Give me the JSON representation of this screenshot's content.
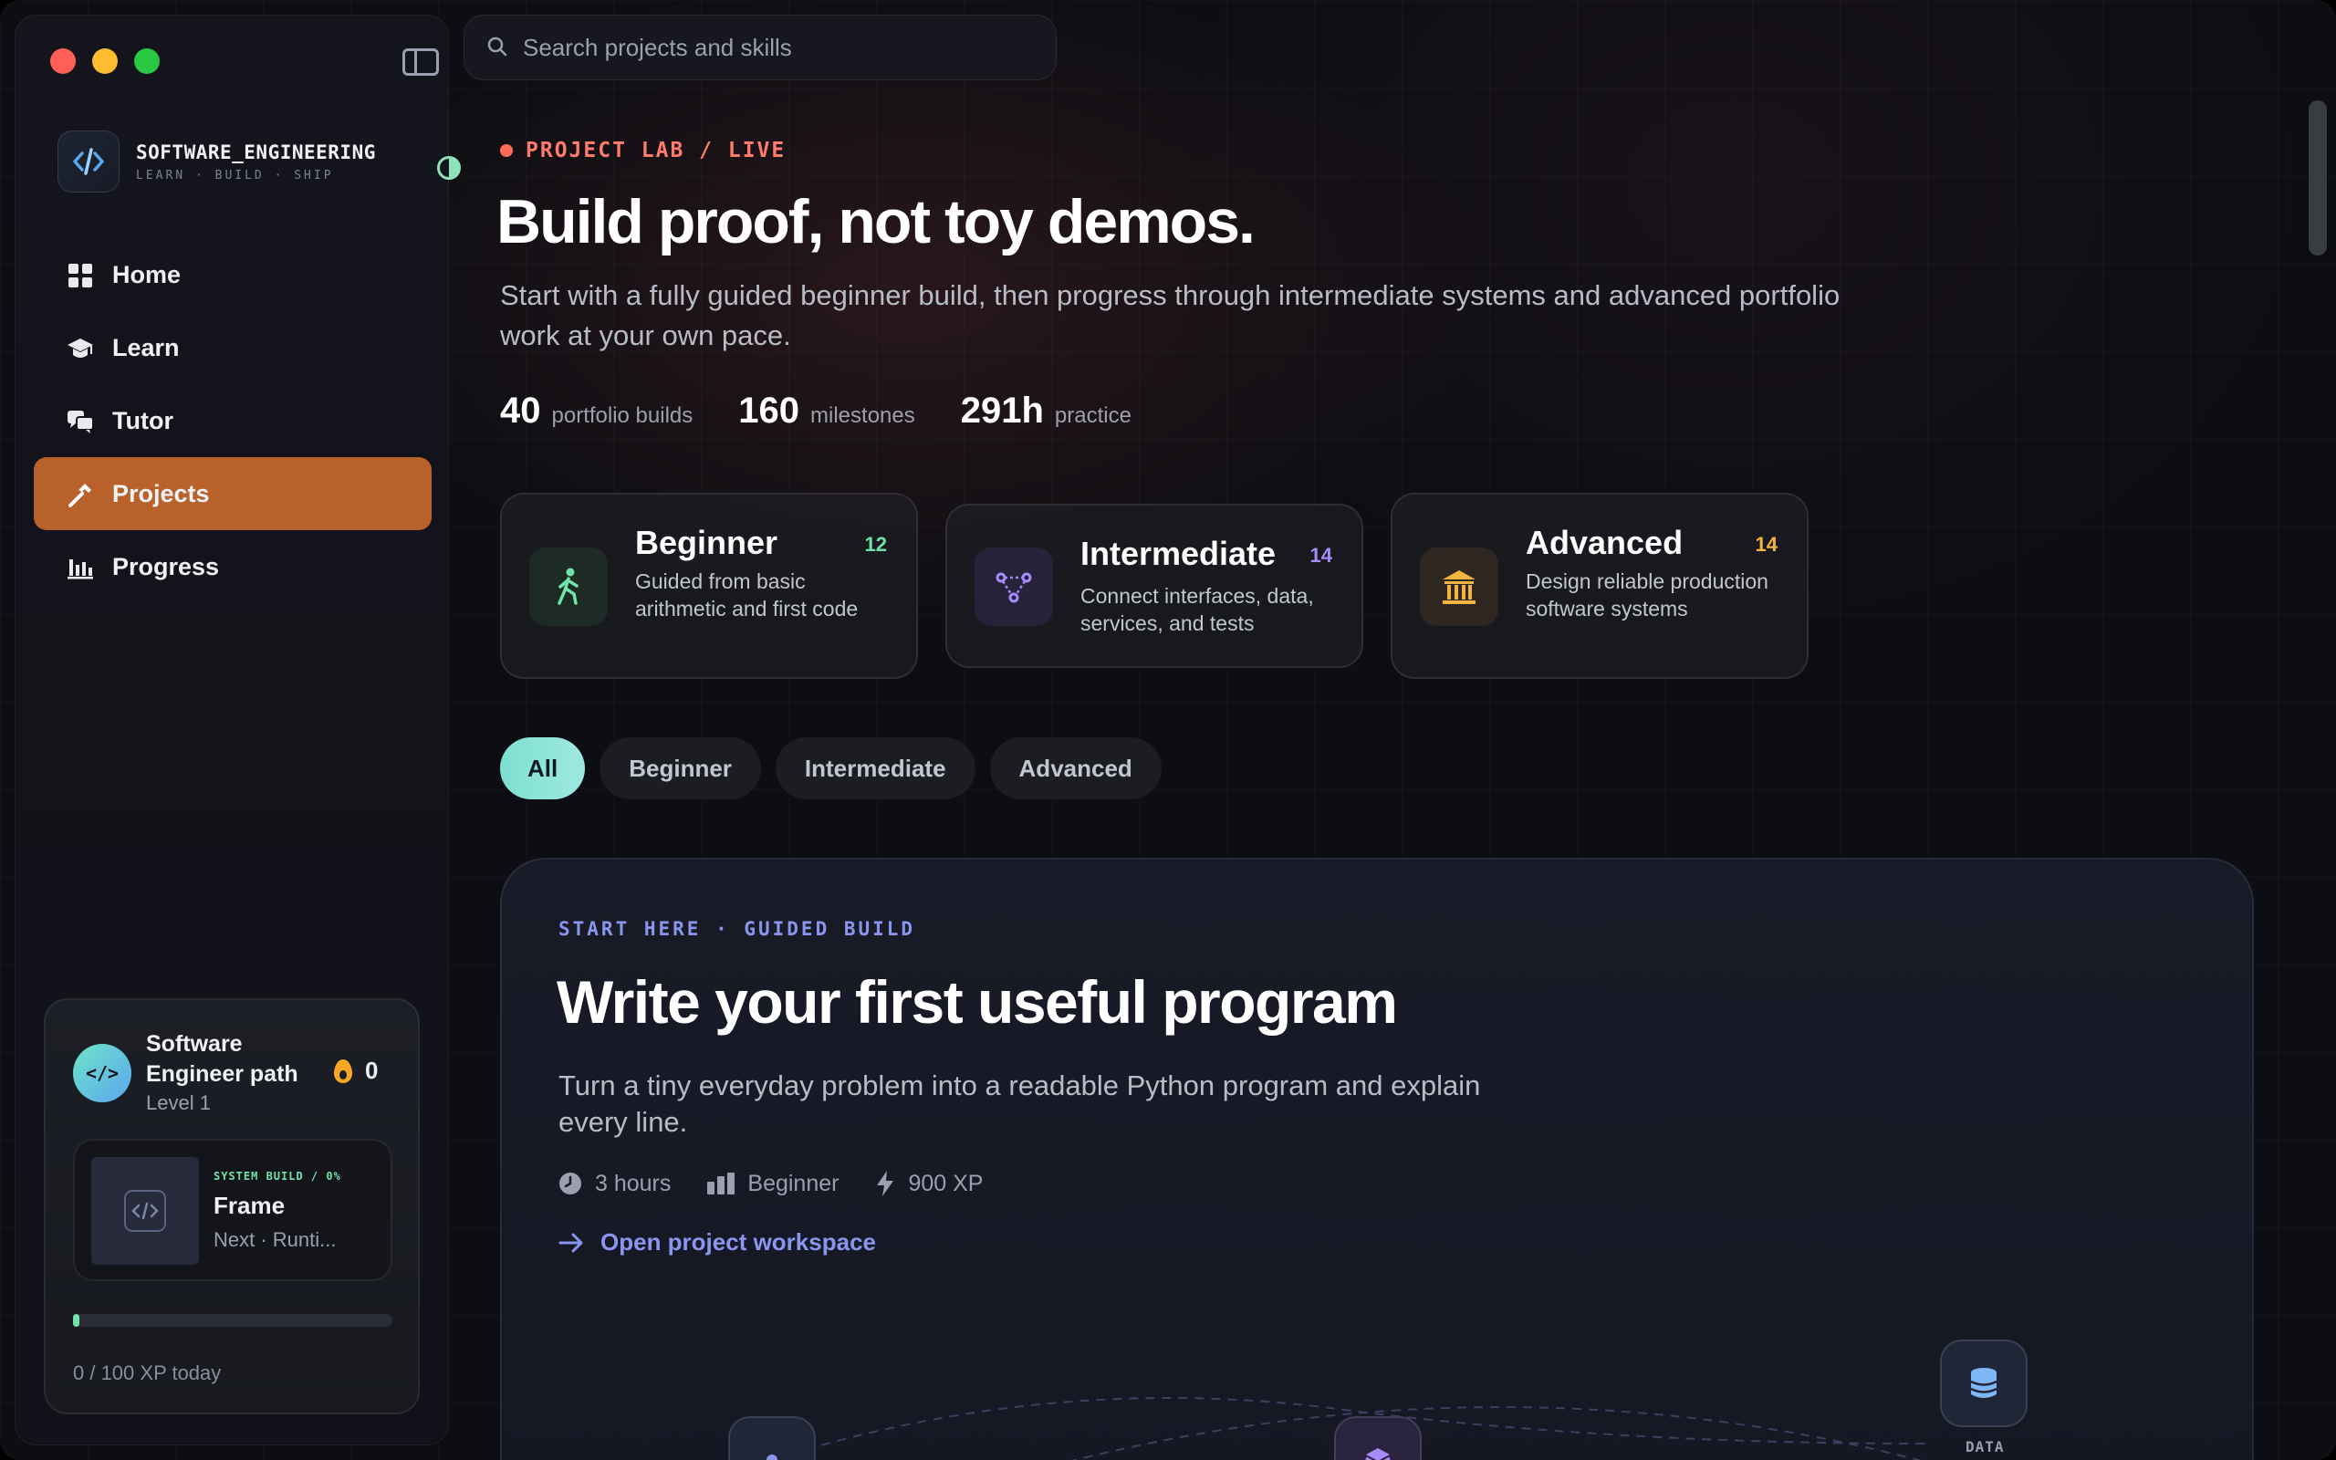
{
  "sidebar": {
    "brand": {
      "title": "SOFTWARE_ENGINEERING",
      "subtitle": "LEARN · BUILD · SHIP"
    },
    "nav": [
      {
        "label": "Home",
        "icon": "grid-icon"
      },
      {
        "label": "Learn",
        "icon": "graduation-cap-icon"
      },
      {
        "label": "Tutor",
        "icon": "chat-bubbles-icon"
      },
      {
        "label": "Projects",
        "icon": "hammer-icon",
        "active": true
      },
      {
        "label": "Progress",
        "icon": "bar-chart-icon"
      }
    ],
    "path_card": {
      "title": "Software Engineer path",
      "level": "Level 1",
      "avatar": "</>",
      "streak": "0",
      "frame": {
        "kicker": "SYSTEM BUILD / 0%",
        "title": "Frame",
        "next": "Next · Runti..."
      },
      "xp_progress": 0.02,
      "xp_label": "0 / 100 XP today"
    }
  },
  "search": {
    "placeholder": "Search projects and skills"
  },
  "hero": {
    "kicker": "PROJECT LAB / LIVE",
    "title": "Build proof, not toy demos.",
    "description": "Start with a fully guided beginner build, then progress through intermediate systems and advanced portfolio work at your own pace.",
    "stats": [
      {
        "value": "40",
        "label": "portfolio builds"
      },
      {
        "value": "160",
        "label": "milestones"
      },
      {
        "value": "291h",
        "label": "practice"
      }
    ]
  },
  "levels": [
    {
      "name": "Beginner",
      "count": "12",
      "description": "Guided from basic arithmetic and first code",
      "icon": "walking-person-icon",
      "color": "#6fe3a8"
    },
    {
      "name": "Intermediate",
      "count": "14",
      "description": "Connect interfaces, data, services, and tests",
      "icon": "network-nodes-icon",
      "color": "#a78bfa"
    },
    {
      "name": "Advanced",
      "count": "14",
      "description": "Design reliable production software systems",
      "icon": "institution-icon",
      "color": "#f5b342"
    }
  ],
  "filters": [
    "All",
    "Beginner",
    "Intermediate",
    "Advanced"
  ],
  "project": {
    "kicker": "START HERE · GUIDED BUILD",
    "title": "Write your first useful program",
    "description": "Turn a tiny everyday problem into a readable Python program and explain every line.",
    "meta": [
      {
        "icon": "clock-icon",
        "text": "3 hours"
      },
      {
        "icon": "difficulty-bars-icon",
        "text": "Beginner"
      },
      {
        "icon": "lightning-icon",
        "text": "900 XP"
      }
    ],
    "link": "Open project workspace",
    "diagram_label": "DATA"
  }
}
